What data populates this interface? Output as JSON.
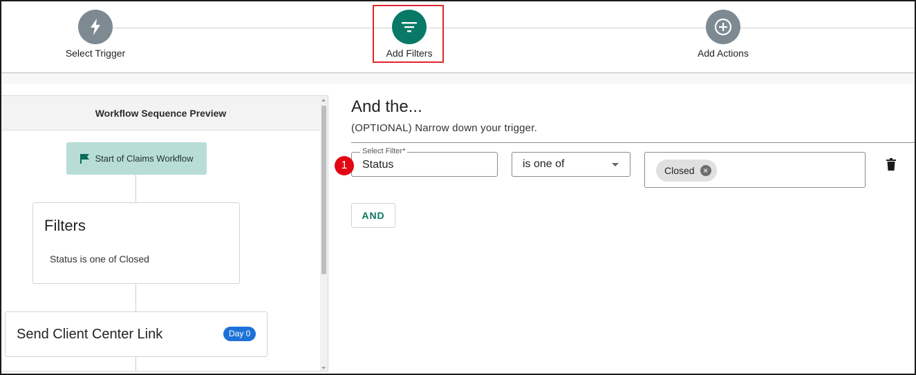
{
  "stepper": {
    "steps": [
      {
        "label": "Select Trigger",
        "icon": "lightning-icon",
        "state": "done"
      },
      {
        "label": "Add Filters",
        "icon": "filter-icon",
        "state": "active"
      },
      {
        "label": "Add Actions",
        "icon": "plus-circle-icon",
        "state": "upcoming"
      }
    ]
  },
  "preview": {
    "header": "Workflow Sequence Preview",
    "start_node": "Start of Claims Workflow",
    "filters_card": {
      "title": "Filters",
      "text": "Status is one of Closed"
    },
    "action_card": {
      "title": "Send Client Center Link",
      "badge": "Day 0"
    }
  },
  "filters": {
    "title": "And the...",
    "subtitle": "(OPTIONAL) Narrow down your trigger.",
    "marker": "1",
    "field_label": "Select Filter*",
    "field_value": "Status",
    "operator": "is one of",
    "values": [
      "Closed"
    ],
    "and_button": "AND"
  },
  "colors": {
    "accent": "#077966",
    "step_inactive": "#7d8a92",
    "highlight": "#e0252b",
    "start_node_bg": "#b8ddd7",
    "badge_blue": "#1d72d8",
    "marker_red": "#e30613"
  }
}
